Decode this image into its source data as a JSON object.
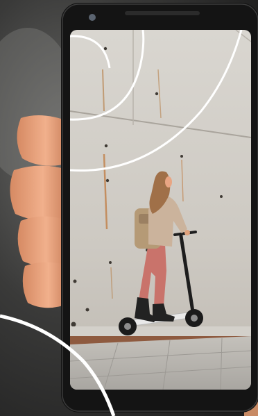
{
  "scene": {
    "subject": "phone-held-in-hand",
    "screen_photo": "person-riding-electric-scooter-by-concrete-wall"
  },
  "colors": {
    "background_dark": "#2a2a2a",
    "phone_body": "#141414",
    "concrete_wall": "#cfcbc4",
    "pavement": "#b9b6b1",
    "sweater": "#cbb39c",
    "trousers": "#c9736b",
    "hair": "#a07048",
    "skin": "#e8a583",
    "decorative_arc": "#ffffff"
  }
}
